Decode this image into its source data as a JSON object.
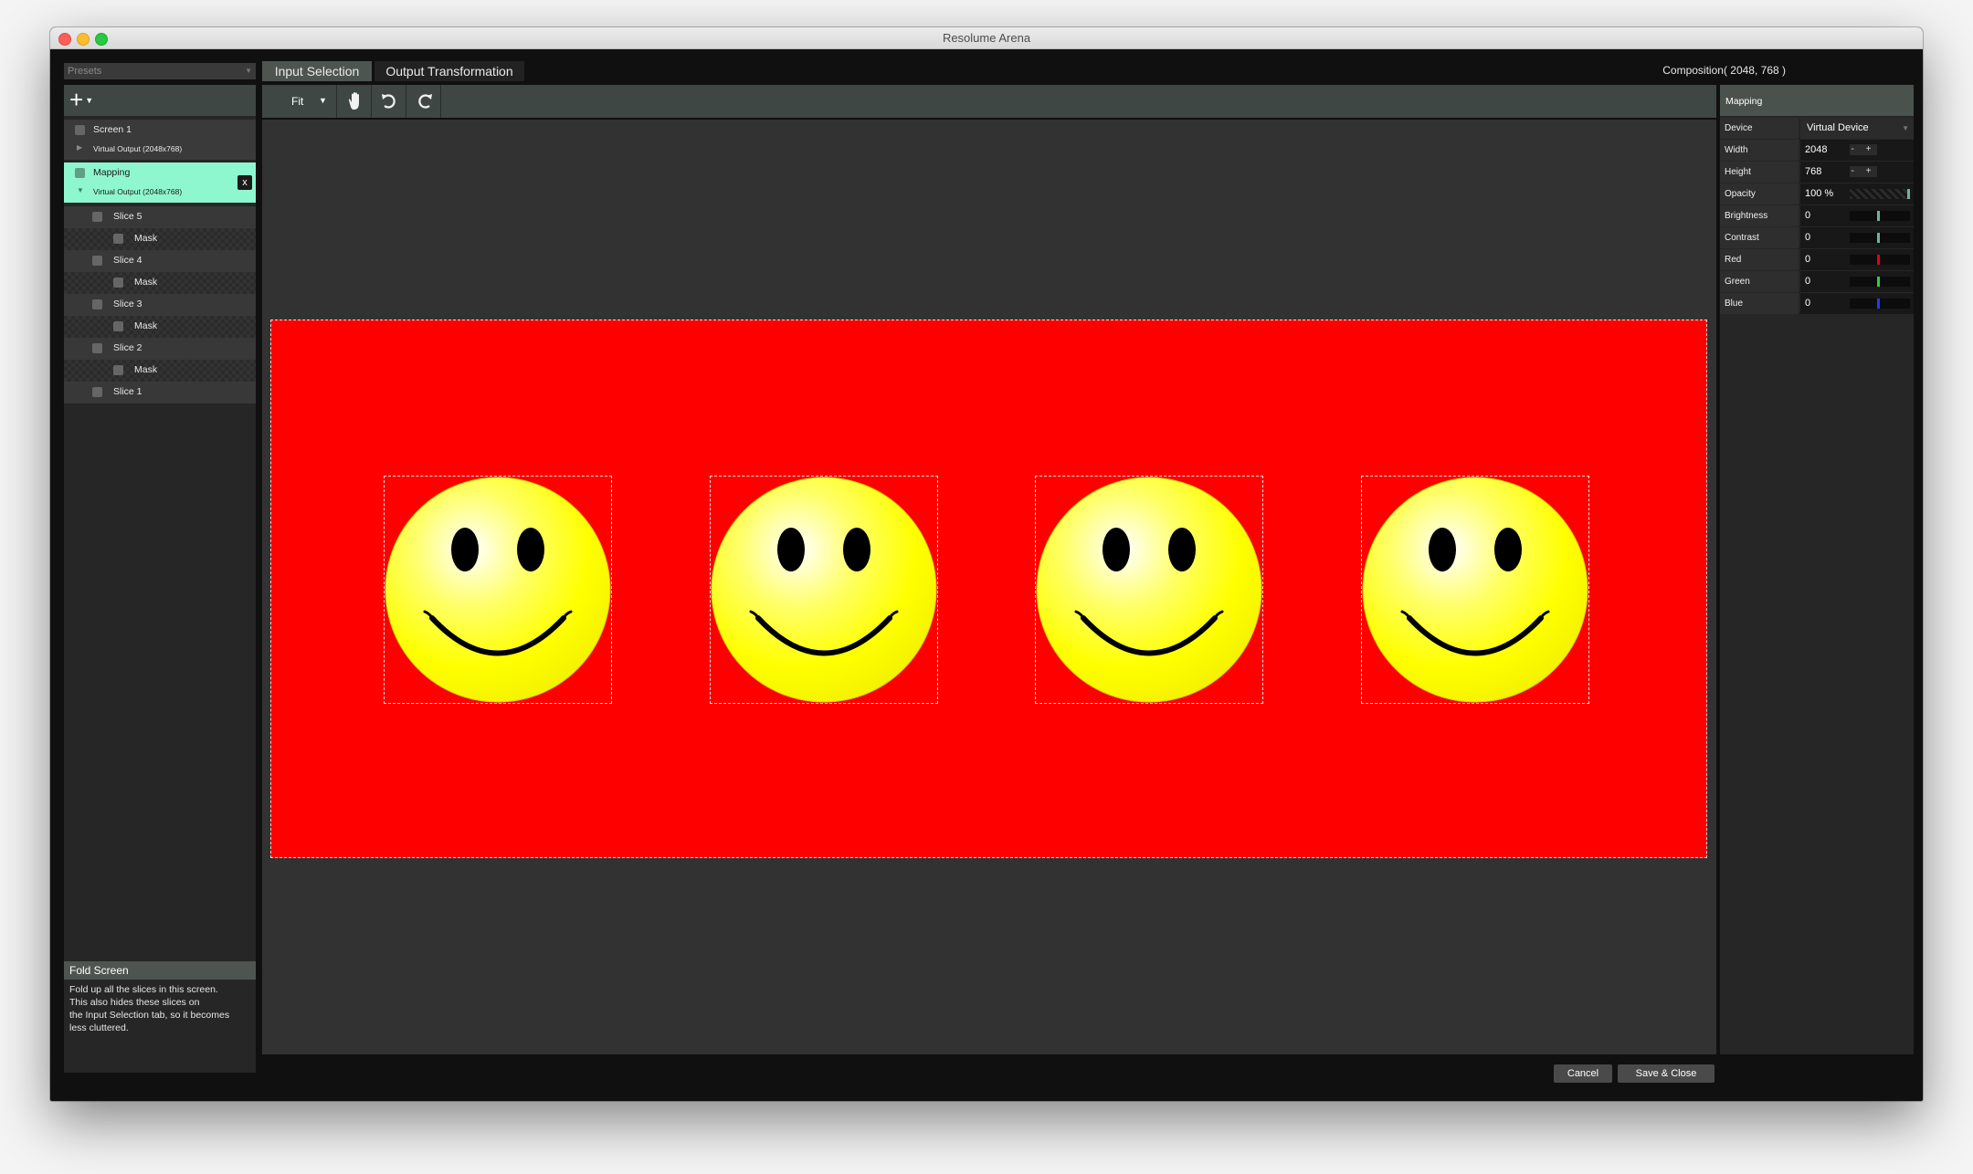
{
  "window": {
    "title": "Resolume Arena"
  },
  "presets": {
    "label": "Presets"
  },
  "tabs": [
    {
      "label": "Input Selection",
      "active": true
    },
    {
      "label": "Output Transformation",
      "active": false
    }
  ],
  "composition_label": "Composition( 2048, 768 )",
  "toolbar": {
    "zoom": "Fit",
    "icons": [
      "hand-icon",
      "undo-icon",
      "redo-icon"
    ]
  },
  "tree": {
    "screen1": {
      "label": "Screen 1",
      "output": "Virtual Output (2048x768)"
    },
    "mapping": {
      "label": "Mapping",
      "output": "Virtual Output (2048x768)",
      "close": "x",
      "color": "#8ff7cf"
    },
    "slices": [
      {
        "label": "Slice 5",
        "mask": "Mask"
      },
      {
        "label": "Slice 4",
        "mask": "Mask"
      },
      {
        "label": "Slice 3",
        "mask": "Mask"
      },
      {
        "label": "Slice 2",
        "mask": "Mask"
      },
      {
        "label": "Slice 1"
      }
    ]
  },
  "help": {
    "title": "Fold Screen",
    "text": "Fold up all the slices in this screen.\nThis also hides these slices on\nthe Input Selection tab, so it becomes\nless cluttered."
  },
  "canvas": {
    "background_color": "#ff0000",
    "smiley_color": "#ffff00",
    "smiley_count": 4
  },
  "properties": {
    "header": "Mapping",
    "device": {
      "name": "Device",
      "value": "Virtual Device"
    },
    "width": {
      "name": "Width",
      "value": "2048",
      "stepper": "- +"
    },
    "height": {
      "name": "Height",
      "value": "768",
      "stepper": "- +"
    },
    "opacity": {
      "name": "Opacity",
      "value": "100 %"
    },
    "brightness": {
      "name": "Brightness",
      "value": "0",
      "color": "#6fb59a"
    },
    "contrast": {
      "name": "Contrast",
      "value": "0",
      "color": "#6fb59a"
    },
    "red": {
      "name": "Red",
      "value": "0",
      "color": "#e3001b"
    },
    "green": {
      "name": "Green",
      "value": "0",
      "color": "#2fd12f"
    },
    "blue": {
      "name": "Blue",
      "value": "0",
      "color": "#1f3cff"
    }
  },
  "buttons": {
    "cancel": "Cancel",
    "save": "Save & Close"
  }
}
